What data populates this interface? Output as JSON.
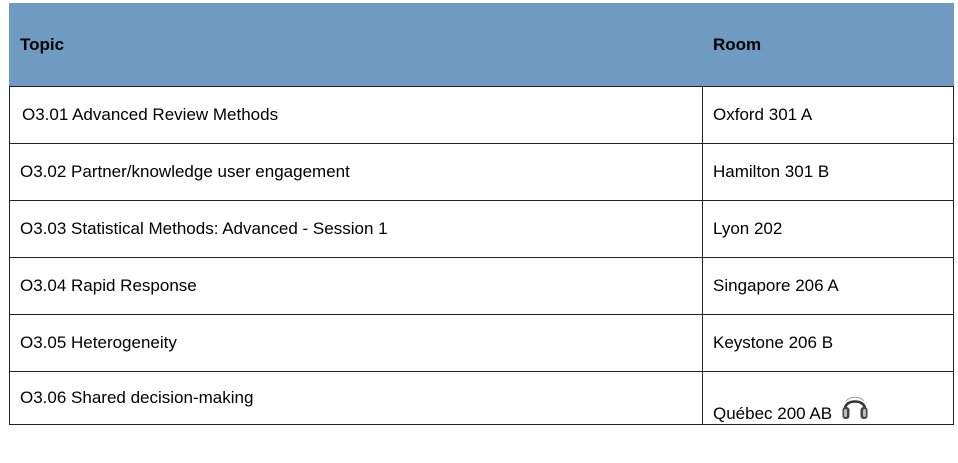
{
  "header": {
    "topic_label": "Topic",
    "room_label": "Room"
  },
  "rows": [
    {
      "topic": "O3.01 Advanced Review Methods",
      "room": "Oxford 301 A"
    },
    {
      "topic": "O3.02 Partner/knowledge user engagement",
      "room": "Hamilton 301 B"
    },
    {
      "topic": "O3.03 Statistical Methods: Advanced - Session 1",
      "room": "Lyon 202"
    },
    {
      "topic": "O3.04 Rapid Response",
      "room": "Singapore 206 A"
    },
    {
      "topic": "O3.05 Heterogeneity",
      "room": "Keystone 206 B"
    },
    {
      "topic": "O3.06 Shared decision-making",
      "room": "Québec 200 AB",
      "icon": "headphones-icon"
    }
  ],
  "colors": {
    "header_background": "#6f9bc3",
    "border": "#222222"
  }
}
